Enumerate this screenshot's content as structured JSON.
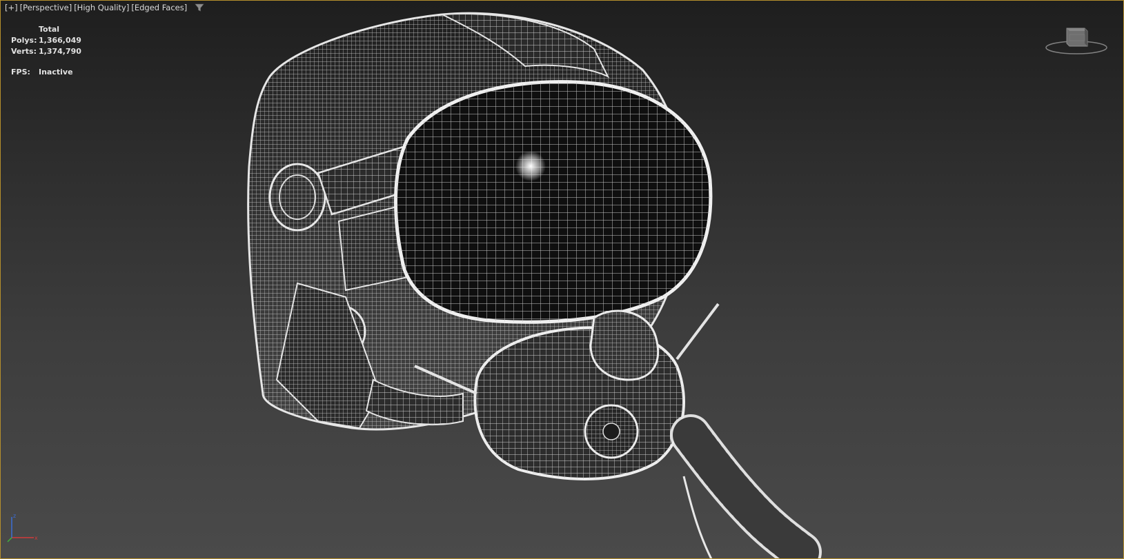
{
  "viewport": {
    "labels": {
      "plus": "[+]",
      "view": "[Perspective]",
      "shading": "[High Quality]",
      "edges": "[Edged Faces]"
    },
    "icons": {
      "filter": "filter-icon",
      "viewcube": "viewcube-icon",
      "axis": "axis-tripod-icon"
    },
    "colors": {
      "active_border": "#b58f2c",
      "wire": "#e8e8e8"
    }
  },
  "stats": {
    "header": "Total",
    "polys_label": "Polys:",
    "polys_value": "1,366,049",
    "verts_label": "Verts:",
    "verts_value": "1,374,790",
    "fps_label": "FPS:",
    "fps_value": "Inactive"
  },
  "axis": {
    "x": "x",
    "z": "z"
  }
}
